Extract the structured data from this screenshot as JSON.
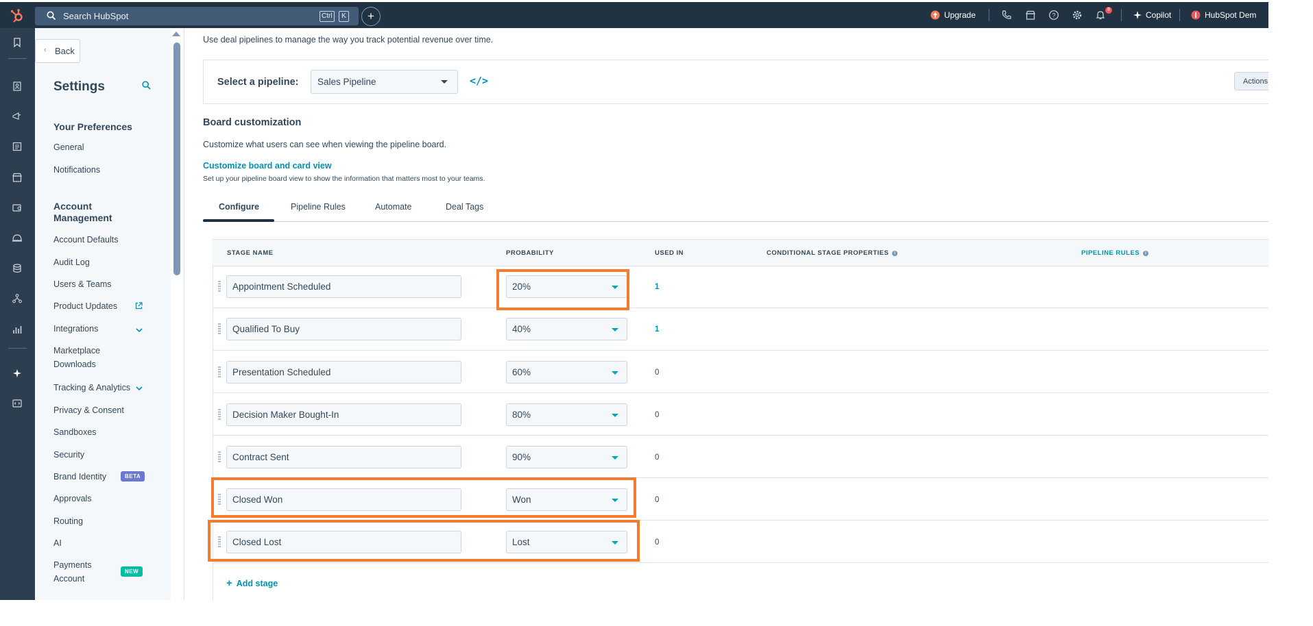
{
  "topbar": {
    "search_placeholder": "Search HubSpot",
    "kbd_ctrl": "Ctrl",
    "kbd_k": "K",
    "plus": "+",
    "upgrade": "Upgrade",
    "copilot": "Copilot",
    "account": "HubSpot Dem",
    "notification_count": "8"
  },
  "sidebar": {
    "back": "Back",
    "title": "Settings",
    "sections": {
      "prefs": "Your Preferences",
      "account": "Account Management"
    },
    "prefs_items": [
      "General",
      "Notifications"
    ],
    "account_items": {
      "defaults": "Account Defaults",
      "audit": "Audit Log",
      "users": "Users & Teams",
      "product_updates": "Product Updates",
      "integrations": "Integrations",
      "marketplace": "Marketplace Downloads",
      "tracking": "Tracking & Analytics",
      "privacy": "Privacy & Consent",
      "sandboxes": "Sandboxes",
      "security": "Security",
      "brand": "Brand Identity",
      "approvals": "Approvals",
      "routing": "Routing",
      "ai": "AI",
      "payments": "Payments Account"
    },
    "badges": {
      "beta": "BETA",
      "new": "NEW"
    }
  },
  "main": {
    "intro": "Use deal pipelines to manage the way you track potential revenue over time.",
    "pipeline_label": "Select a pipeline:",
    "pipeline_value": "Sales Pipeline",
    "actions": "Actions",
    "board_title": "Board customization",
    "board_desc": "Customize what users can see when viewing the pipeline board.",
    "board_link": "Customize board and card view",
    "board_sub": "Set up your pipeline board view to show the information that matters most to your teams.",
    "tabs": [
      "Configure",
      "Pipeline Rules",
      "Automate",
      "Deal Tags"
    ],
    "columns": {
      "stage": "STAGE NAME",
      "probability": "PROBABILITY",
      "used_in": "USED IN",
      "conditional": "CONDITIONAL STAGE PROPERTIES",
      "rules": "PIPELINE RULES"
    },
    "stages": [
      {
        "name": "Appointment Scheduled",
        "probability": "20%",
        "used_in": "1"
      },
      {
        "name": "Qualified To Buy",
        "probability": "40%",
        "used_in": "1"
      },
      {
        "name": "Presentation Scheduled",
        "probability": "60%",
        "used_in": "0"
      },
      {
        "name": "Decision Maker Bought-In",
        "probability": "80%",
        "used_in": "0"
      },
      {
        "name": "Contract Sent",
        "probability": "90%",
        "used_in": "0"
      },
      {
        "name": "Closed Won",
        "probability": "Won",
        "used_in": "0"
      },
      {
        "name": "Closed Lost",
        "probability": "Lost",
        "used_in": "0"
      }
    ],
    "add_stage": "Add stage"
  },
  "colors": {
    "topbar": "#213343",
    "rail": "#2d3e50",
    "link": "#0091ae",
    "highlight": "#f47c2c",
    "beta_badge": "#6a78d1",
    "new_badge": "#00bda5"
  }
}
